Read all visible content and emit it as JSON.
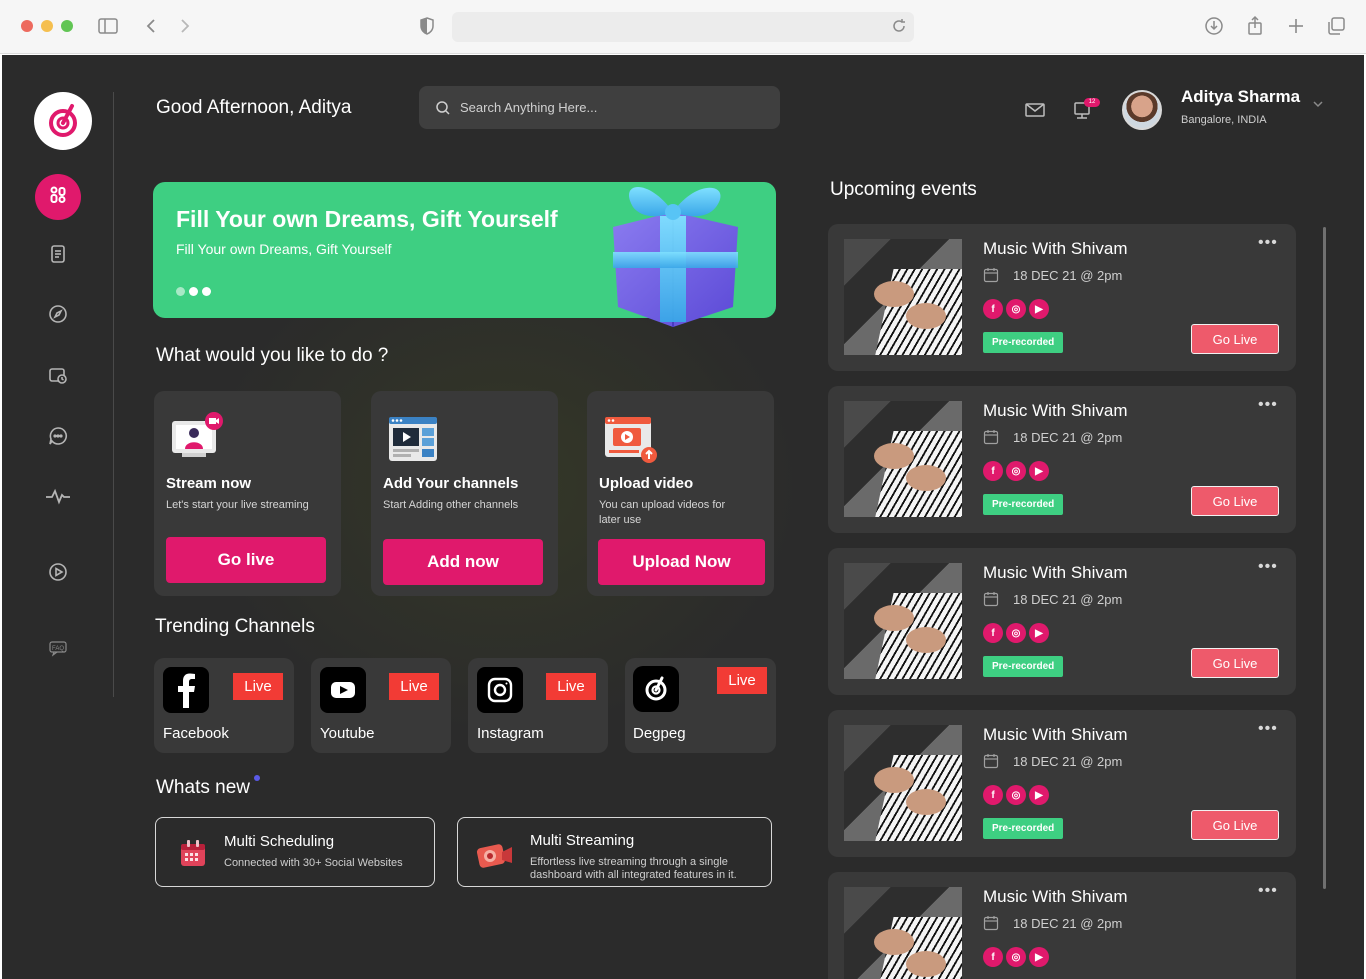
{
  "header": {
    "greeting": "Good Afternoon, Aditya",
    "search_placeholder": "Search Anything Here...",
    "notification_count": "12",
    "user_name": "Aditya Sharma",
    "user_location": "Bangalore, INDIA"
  },
  "sidebar": {
    "items": [
      {
        "icon": "dashboard-icon",
        "active": true
      },
      {
        "icon": "document-icon"
      },
      {
        "icon": "compass-icon"
      },
      {
        "icon": "schedule-icon"
      },
      {
        "icon": "chat-icon"
      },
      {
        "icon": "activity-icon"
      },
      {
        "icon": "play-icon"
      },
      {
        "icon": "faq-icon"
      }
    ]
  },
  "banner": {
    "title": "Fill Your own Dreams, Gift Yourself",
    "subtitle": "Fill Your own Dreams, Gift Yourself",
    "color": "#3ecf82"
  },
  "actions": {
    "title": "What would you like to do ?",
    "cards": [
      {
        "title": "Stream now",
        "subtitle": "Let's start your live streaming",
        "button": "Go live"
      },
      {
        "title": "Add Your channels",
        "subtitle": "Start Adding other channels",
        "button": "Add now"
      },
      {
        "title": "Upload video",
        "subtitle": "You can upload videos for later use",
        "button": "Upload Now"
      }
    ]
  },
  "trending": {
    "title": "Trending Channels",
    "live_label": "Live",
    "channels": [
      {
        "name": "Facebook",
        "icon": "facebook-icon"
      },
      {
        "name": "Youtube",
        "icon": "youtube-icon"
      },
      {
        "name": "Instagram",
        "icon": "instagram-icon"
      },
      {
        "name": "Degpeg",
        "icon": "degpeg-icon"
      }
    ]
  },
  "whats_new": {
    "title": "Whats new",
    "items": [
      {
        "title": "Multi Scheduling",
        "subtitle": "Connected with 30+ Social Websites"
      },
      {
        "title": "Multi Streaming",
        "subtitle": "Effortless live streaming through a single dashboard with all integrated features in it."
      }
    ]
  },
  "events": {
    "title": "Upcoming events",
    "items": [
      {
        "name": "Music With Shivam",
        "date": "18 DEC 21 @ 2pm",
        "tag": "Pre-recorded",
        "button": "Go Live"
      },
      {
        "name": "Music With Shivam",
        "date": "18 DEC 21 @ 2pm",
        "tag": "Pre-recorded",
        "button": "Go Live"
      },
      {
        "name": "Music With Shivam",
        "date": "18 DEC 21 @ 2pm",
        "tag": "Pre-recorded",
        "button": "Go Live"
      },
      {
        "name": "Music With Shivam",
        "date": "18 DEC 21 @ 2pm",
        "tag": "Pre-recorded",
        "button": "Go Live"
      },
      {
        "name": "Music With Shivam",
        "date": "18 DEC 21 @ 2pm"
      }
    ]
  },
  "colors": {
    "accent": "#e0196c",
    "live": "#f23b35",
    "go_live": "#ee5a6b",
    "background": "#2b2b2b",
    "card": "#393939"
  }
}
